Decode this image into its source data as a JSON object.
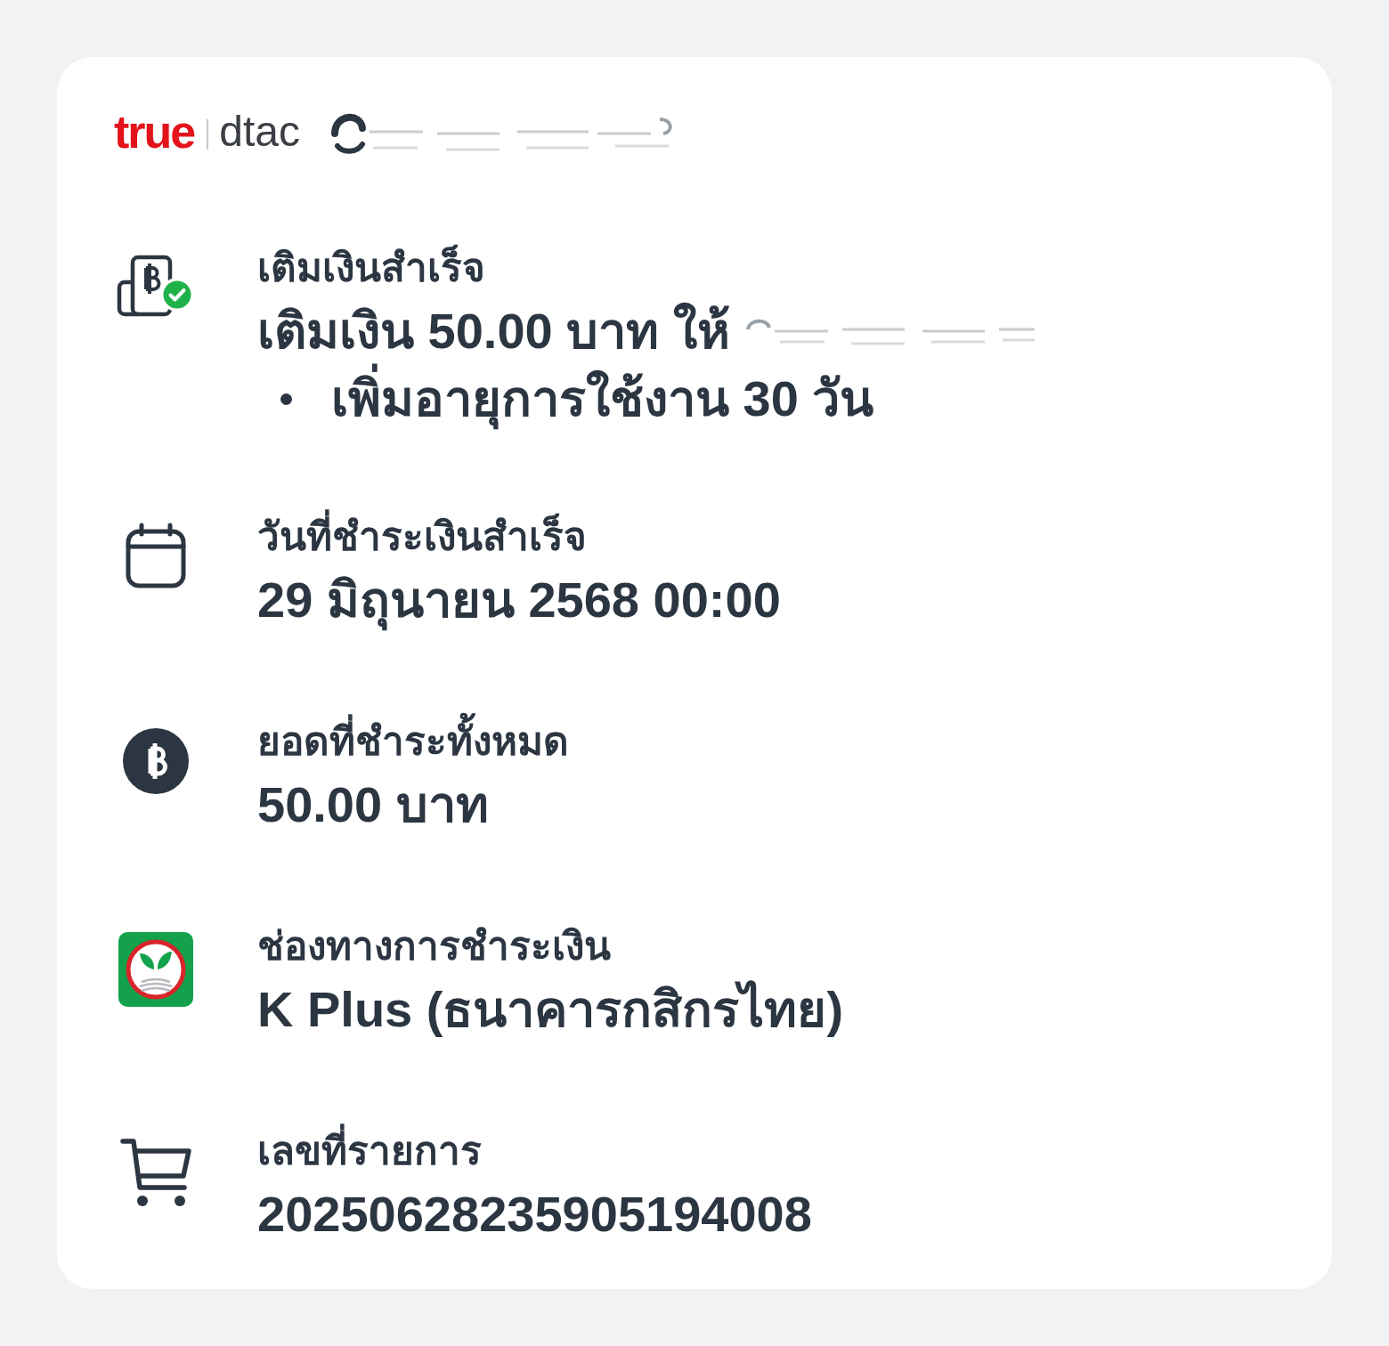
{
  "header": {
    "logo": {
      "primary": "true",
      "secondary": "dtac"
    },
    "phone_number": {
      "redacted": true
    }
  },
  "details": [
    {
      "kind": "topup",
      "label": "เติมเงินสำเร็จ",
      "value": "เติมเงิน 50.00 บาท ให้",
      "value_redacted": true,
      "bullets": [
        "เพิ่มอายุการใช้งาน 30 วัน"
      ]
    },
    {
      "kind": "date",
      "label": "วันที่ชำระเงินสำเร็จ",
      "value": "29 มิถุนายน 2568 00:00"
    },
    {
      "kind": "amount",
      "label": "ยอดที่ชำระทั้งหมด",
      "value": "50.00 บาท"
    },
    {
      "kind": "bank",
      "label": "ช่องทางการชำระเงิน",
      "value": "K Plus (ธนาคารกสิกรไทย)"
    },
    {
      "kind": "order",
      "label": "เลขที่รายการ",
      "value": "20250628235905194008"
    }
  ]
}
